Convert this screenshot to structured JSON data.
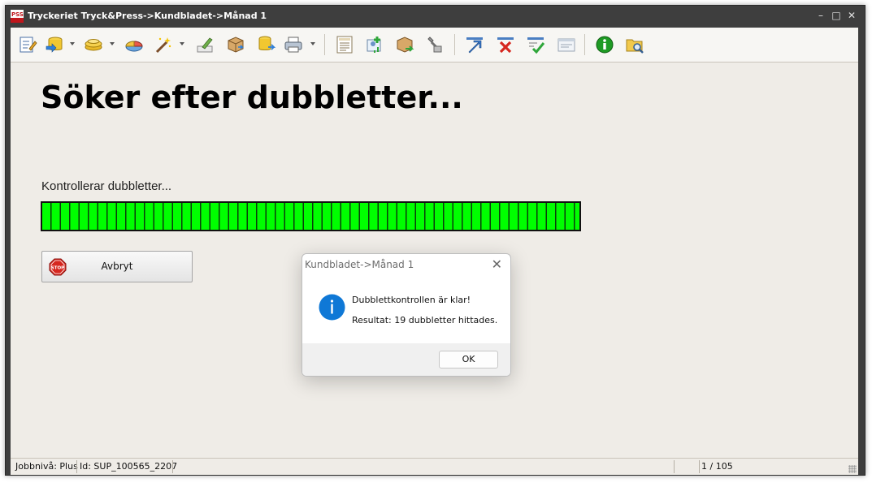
{
  "window": {
    "title": "Tryckeriet Tryck&Press->Kundbladet->Månad 1",
    "app_icon": "pss-logo-icon",
    "controls": [
      "minimize-icon",
      "maximize-icon",
      "close-icon"
    ]
  },
  "toolbar": {
    "icons": [
      "edit-notes-icon",
      "database-export-icon",
      "coins-icon",
      "pie-chart-icon",
      "magic-wand-icon",
      "pen-edit-icon",
      "package-icon",
      "database-arrow-icon",
      "printer-icon",
      "document-list-icon",
      "add-contact-icon",
      "box-arrow-icon",
      "tools-icon",
      "send-arrow-icon",
      "delete-x-icon",
      "checklist-icon",
      "window-layout-icon",
      "info-icon",
      "folder-search-icon"
    ]
  },
  "main": {
    "heading": "Söker efter dubbletter...",
    "status_text": "Kontrollerar dubbletter...",
    "progress_fraction": 1.0,
    "cancel_label": "Avbryt",
    "cancel_icon": "stop-sign-icon"
  },
  "statusbar": {
    "job_level": "Jobbnivå: Plus",
    "id": "Id: SUP_100565_2207",
    "page": "1 / 105"
  },
  "dialog": {
    "title": "Kundbladet->Månad 1",
    "icon": "info-icon",
    "message": "Dubblettkontrollen är klar!",
    "result": "Resultat: 19 dubbletter hittades.",
    "ok_label": "OK"
  },
  "colors": {
    "progress_green": "#00ff00",
    "info_blue": "#0f78d6",
    "stop_red": "#d6271f"
  }
}
